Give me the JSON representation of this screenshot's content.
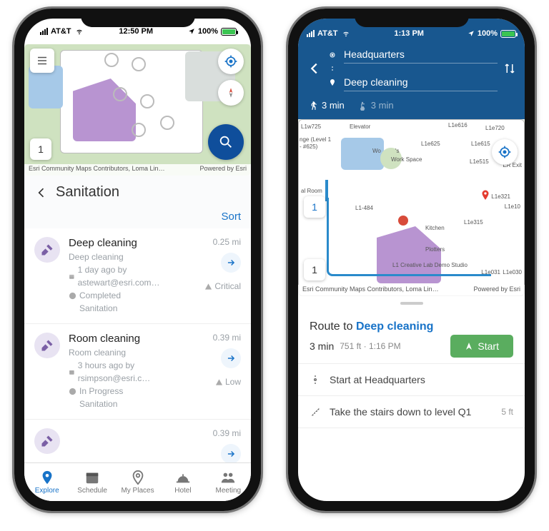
{
  "left": {
    "status": {
      "carrier": "AT&T",
      "time": "12:50 PM",
      "battery": "100%"
    },
    "map": {
      "floor": "1",
      "creditLeft": "Esri Community Maps Contributors, Loma Lin…",
      "creditRight": "Powered by Esri"
    },
    "list": {
      "title": "Sanitation",
      "sort": "Sort",
      "items": [
        {
          "title": "Deep cleaning",
          "sub": "Deep cleaning",
          "time": "1 day ago by astewart@esri.com…",
          "status": "Completed",
          "cat": "Sanitation",
          "dist": "0.25 mi",
          "prio": "Critical"
        },
        {
          "title": "Room cleaning",
          "sub": "Room cleaning",
          "time": "3 hours ago by rsimpson@esri.c…",
          "status": "In Progress",
          "cat": "Sanitation",
          "dist": "0.39 mi",
          "prio": "Low"
        },
        {
          "title": "",
          "dist": "0.39 mi"
        }
      ]
    },
    "tabs": [
      {
        "label": "Explore",
        "active": true
      },
      {
        "label": "Schedule"
      },
      {
        "label": "My Places"
      },
      {
        "label": "Hotel"
      },
      {
        "label": "Meeting"
      }
    ]
  },
  "right": {
    "status": {
      "carrier": "AT&T",
      "time": "1:13 PM",
      "battery": "100%"
    },
    "from": "Headquarters",
    "to": "Deep cleaning",
    "modes": {
      "walk": "3 min",
      "access": "3 min"
    },
    "map": {
      "creditLeft": "Esri Community Maps Contributors, Loma Lin…",
      "creditRight": "Powered by Esri",
      "floorTop": "1",
      "floorBot": "1",
      "labels": [
        "L1w725",
        "Elevator",
        "L1e616",
        "L1e720",
        "L1e615",
        "L1e515",
        "ER Exit",
        "L1e321",
        "L1e10",
        "L1e315",
        "Kitchen",
        "Plotters",
        "L1 Creative Lab Demo Studio",
        "L1e031",
        "L1e030",
        "Work Space",
        "L1e625",
        "L1-484",
        "al Room",
        "Wo",
        "'s",
        "nge (Level 1",
        "- #625)"
      ]
    },
    "route": {
      "prefix": "Route to",
      "dest": "Deep cleaning",
      "dur": "3 min",
      "dist": "751 ft",
      "eta": "1:16 PM",
      "start": "Start"
    },
    "steps": [
      {
        "text": "Start at Headquarters",
        "dist": ""
      },
      {
        "text": "Take the stairs down to level Q1",
        "dist": "5 ft"
      }
    ]
  }
}
